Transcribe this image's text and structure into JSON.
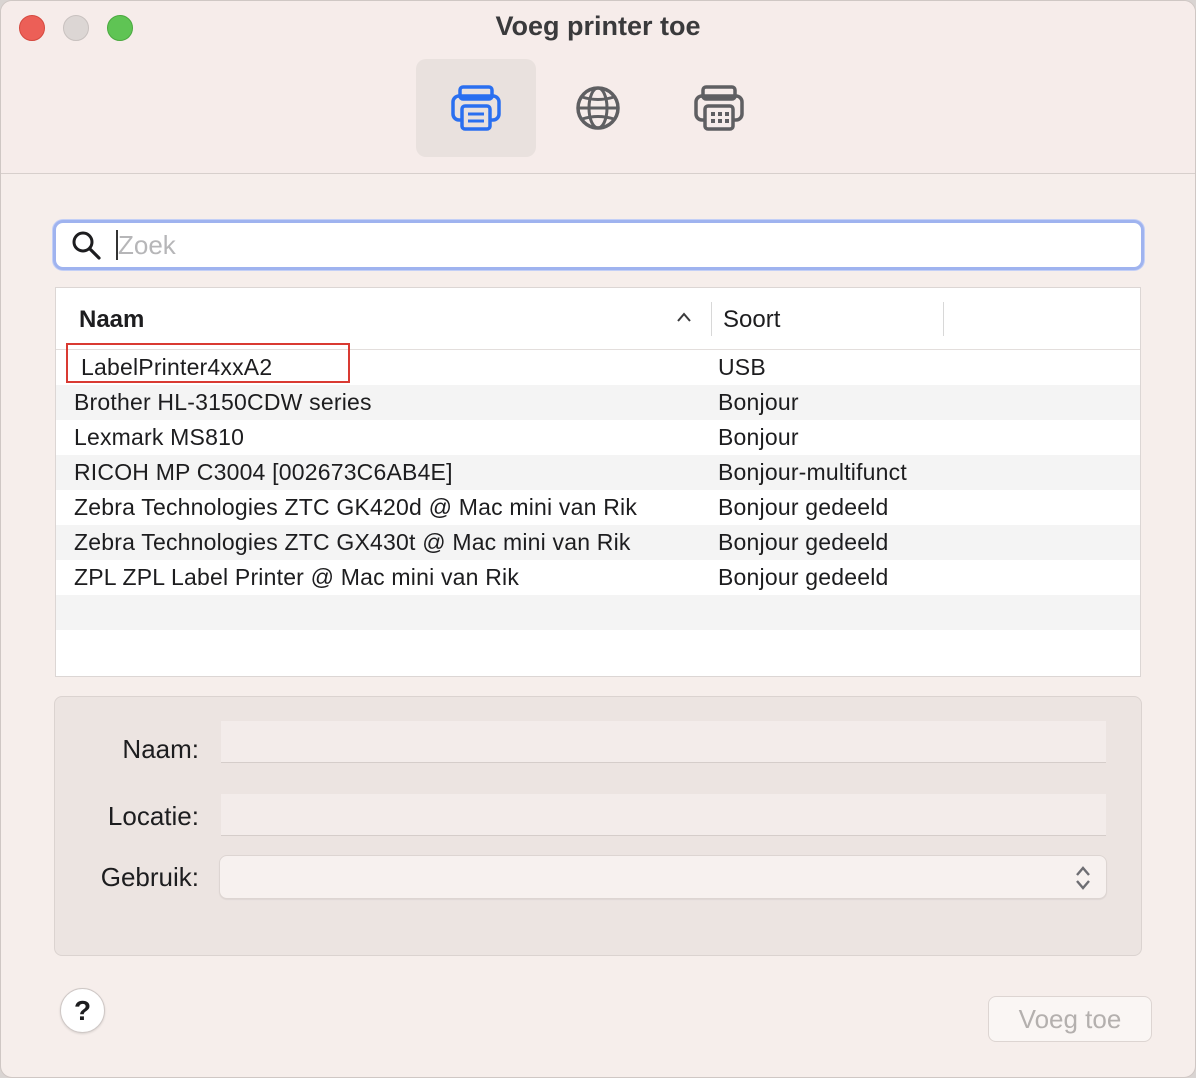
{
  "window": {
    "title": "Voeg printer toe"
  },
  "toolbar": {
    "tabs": [
      {
        "icon": "printer-default-icon",
        "selected": true
      },
      {
        "icon": "globe-ip-icon",
        "selected": false
      },
      {
        "icon": "printer-windows-icon",
        "selected": false
      }
    ]
  },
  "search": {
    "placeholder": "Zoek",
    "value": ""
  },
  "table": {
    "columns": [
      "Naam",
      "Soort"
    ],
    "sort": "ascending",
    "rows": [
      {
        "name": "LabelPrinter4xxA2",
        "kind": "USB"
      },
      {
        "name": "Brother HL-3150CDW series",
        "kind": "Bonjour"
      },
      {
        "name": "Lexmark MS810",
        "kind": "Bonjour"
      },
      {
        "name": "RICOH MP C3004 [002673C6AB4E]",
        "kind": "Bonjour-multifunct"
      },
      {
        "name": "Zebra Technologies ZTC GK420d @ Mac mini van Rik",
        "kind": "Bonjour gedeeld"
      },
      {
        "name": "Zebra Technologies ZTC GX430t @ Mac mini van Rik",
        "kind": "Bonjour gedeeld"
      },
      {
        "name": "ZPL ZPL Label Printer @ Mac mini van Rik",
        "kind": "Bonjour gedeeld"
      },
      {
        "name": "",
        "kind": ""
      },
      {
        "name": "",
        "kind": ""
      }
    ]
  },
  "details": {
    "name_label": "Naam:",
    "name_value": "",
    "location_label": "Locatie:",
    "location_value": "",
    "use_label": "Gebruik:",
    "use_value": ""
  },
  "footer": {
    "help_label": "?",
    "add_label": "Voeg toe"
  },
  "colors": {
    "highlight": "#d93a32",
    "accent": "#2a6ff0"
  }
}
